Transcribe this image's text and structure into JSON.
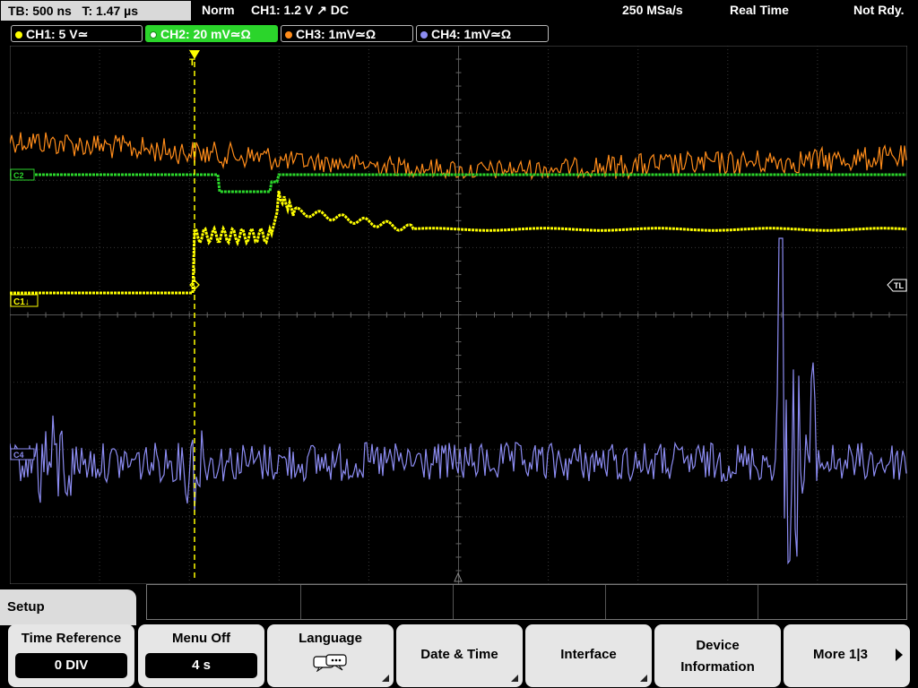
{
  "status": {
    "timebase": "TB: 500 ns",
    "trigger_time": "T: 1.47 µs",
    "trigger_mode": "Norm",
    "trigger_info": "CH1: 1.2 V ↗ DC",
    "sample_rate": "250 MSa/s",
    "acq_mode": "Real Time",
    "state": "Not Rdy."
  },
  "channels": [
    {
      "label": "CH1: 5 V≃",
      "color": "#ffff00",
      "active": false
    },
    {
      "label": "CH2: 20 mV≃Ω",
      "color": "#2bd52b",
      "active": true
    },
    {
      "label": "CH3: 1mV≃Ω",
      "color": "#ff8c1a",
      "active": false
    },
    {
      "label": "CH4: 1mV≃Ω",
      "color": "#8c8cf2",
      "active": false
    }
  ],
  "markers": {
    "ch1": "C1↓",
    "ch2": "C2",
    "ch4": "C4",
    "trigger_level": "TL"
  },
  "colors": {
    "ch1": "#ffff00",
    "ch2": "#2bd52b",
    "ch3": "#ff8c1a",
    "ch4": "#8c8cf2",
    "grid": "#3a3a3a",
    "softkey_bg": "#e6e6e6"
  },
  "menu": {
    "title": "Setup",
    "time_reference": {
      "title": "Time Reference",
      "value": "0 DIV"
    },
    "menu_off": {
      "title": "Menu Off",
      "value": "4 s"
    },
    "language": {
      "title": "Language",
      "icon": "speech-bubble-icon"
    },
    "date_time": "Date & Time",
    "interface": "Interface",
    "device_info_l1": "Device",
    "device_info_l2": "Information",
    "more": "More 1|3"
  }
}
